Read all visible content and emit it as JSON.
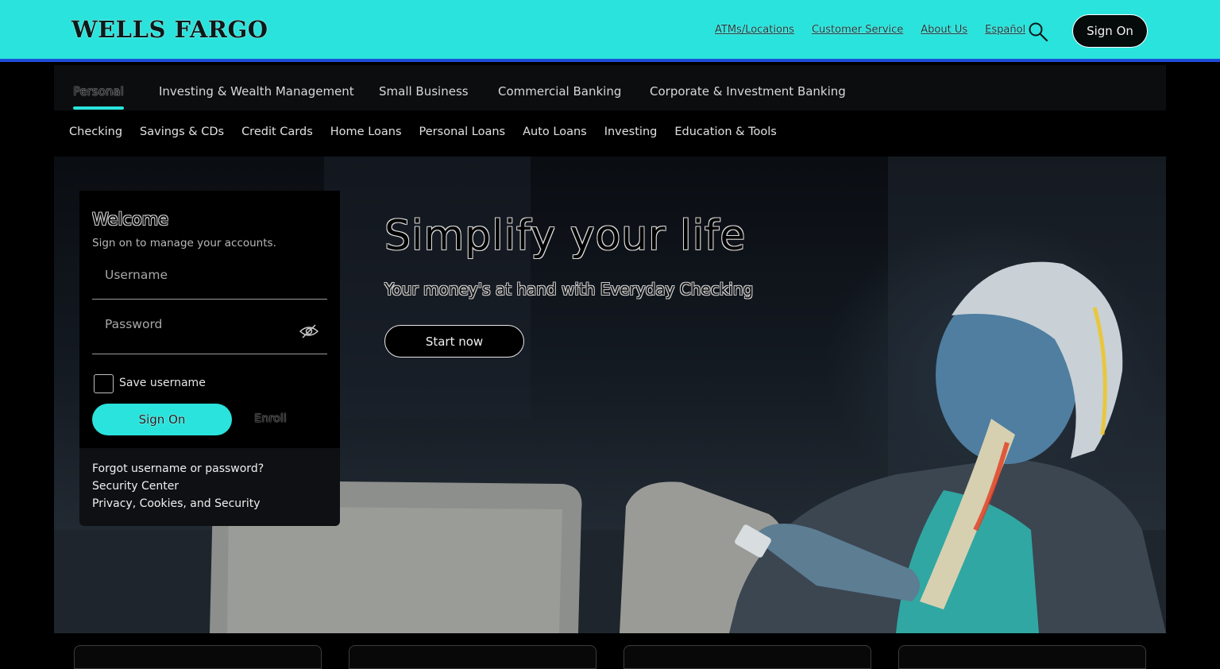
{
  "header": {
    "logo": "WELLS FARGO",
    "links": [
      "ATMs/Locations",
      "Customer Service",
      "About Us",
      "Español"
    ],
    "sign_on": "Sign On",
    "brand_color": "#2ae3dc",
    "accent_line_color": "#1c4ed8"
  },
  "main_nav": {
    "items": [
      "Personal",
      "Investing & Wealth Management",
      "Small Business",
      "Commercial Banking",
      "Corporate & Investment Banking"
    ],
    "active": "Personal"
  },
  "sub_nav": {
    "items": [
      "Checking",
      "Savings & CDs",
      "Credit Cards",
      "Home Loans",
      "Personal Loans",
      "Auto Loans",
      "Investing",
      "Education & Tools"
    ]
  },
  "hero": {
    "title": "Simplify your life",
    "subtitle": "Your money's at hand with Everyday Checking",
    "cta": "Start now"
  },
  "signon_card": {
    "title": "Welcome",
    "subtitle": "Sign on to manage your accounts.",
    "username_placeholder": "Username",
    "password_placeholder": "Password",
    "save_username_label": "Save username",
    "save_username_checked": false,
    "sign_on_label": "Sign On",
    "enroll_label": "Enroll",
    "links": [
      "Forgot username or password?",
      "Security Center",
      "Privacy, Cookies, and Security"
    ]
  },
  "icons": {
    "search": "search-icon",
    "password_toggle": "eye-slash-icon"
  }
}
